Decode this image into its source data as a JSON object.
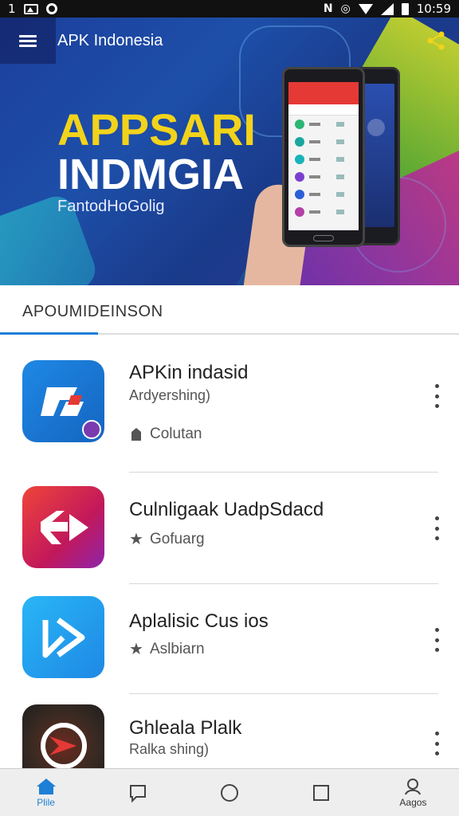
{
  "status_bar": {
    "left_text": "1",
    "time": "10:59"
  },
  "app_bar": {
    "title": "APK Indonesia",
    "menu_icon": "menu-icon",
    "share_icon": "share-icon"
  },
  "hero": {
    "title_line1": "APPSARI",
    "title_line2": "INDMGIA",
    "subtitle": "FantodHoGolig"
  },
  "section": {
    "tab_label": "APOUMIDEINSON"
  },
  "apps": [
    {
      "name": "APKin indasid",
      "developer": "Ardyershing)",
      "meta": "Colutan",
      "meta_icon": "tag-icon"
    },
    {
      "name": "Culnligaak UadpSdacd",
      "developer": "",
      "meta": "Gofuarg",
      "meta_icon": "star-icon"
    },
    {
      "name": "Aplalisic Cus ios",
      "developer": "",
      "meta": "Aslbiarn",
      "meta_icon": "star-icon"
    },
    {
      "name": "Ghleala Plalk",
      "developer": "Ralka shing)",
      "meta": "",
      "meta_icon": ""
    }
  ],
  "bottom_nav": {
    "home_label": "Plile",
    "profile_label": "Aagos"
  },
  "colors": {
    "accent": "#1e7fd6",
    "hero_title": "#f2d31b"
  }
}
